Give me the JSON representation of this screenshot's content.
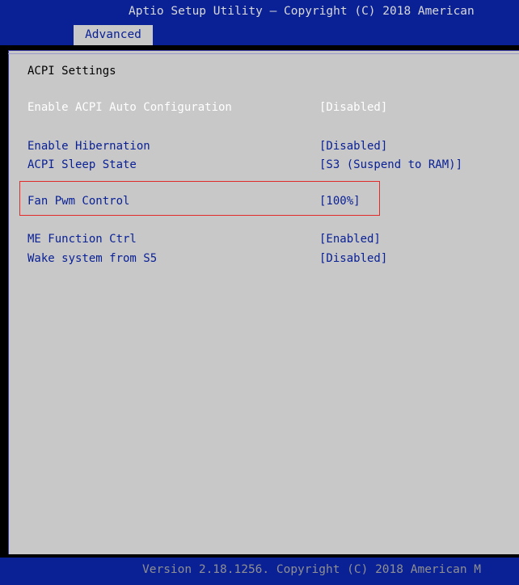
{
  "header": {
    "title": "Aptio Setup Utility – Copyright (C) 2018 American",
    "active_tab": "Advanced"
  },
  "section": {
    "title": "ACPI Settings"
  },
  "settings": [
    {
      "label": "Enable ACPI Auto Configuration",
      "value": "[Disabled]"
    },
    {
      "label": "Enable Hibernation",
      "value": "[Disabled]"
    },
    {
      "label": "ACPI Sleep State",
      "value": "[S3 (Suspend to RAM)]"
    },
    {
      "label": "Fan Pwm Control",
      "value": "[100%]"
    },
    {
      "label": "ME Function Ctrl",
      "value": "[Enabled]"
    },
    {
      "label": "Wake system from S5",
      "value": "[Disabled]"
    }
  ],
  "footer": {
    "text": "Version 2.18.1256. Copyright (C) 2018 American M"
  },
  "colors": {
    "bar_blue": "#0a2196",
    "panel_gray": "#c8c8c8",
    "highlight_red": "#e02b2b"
  }
}
